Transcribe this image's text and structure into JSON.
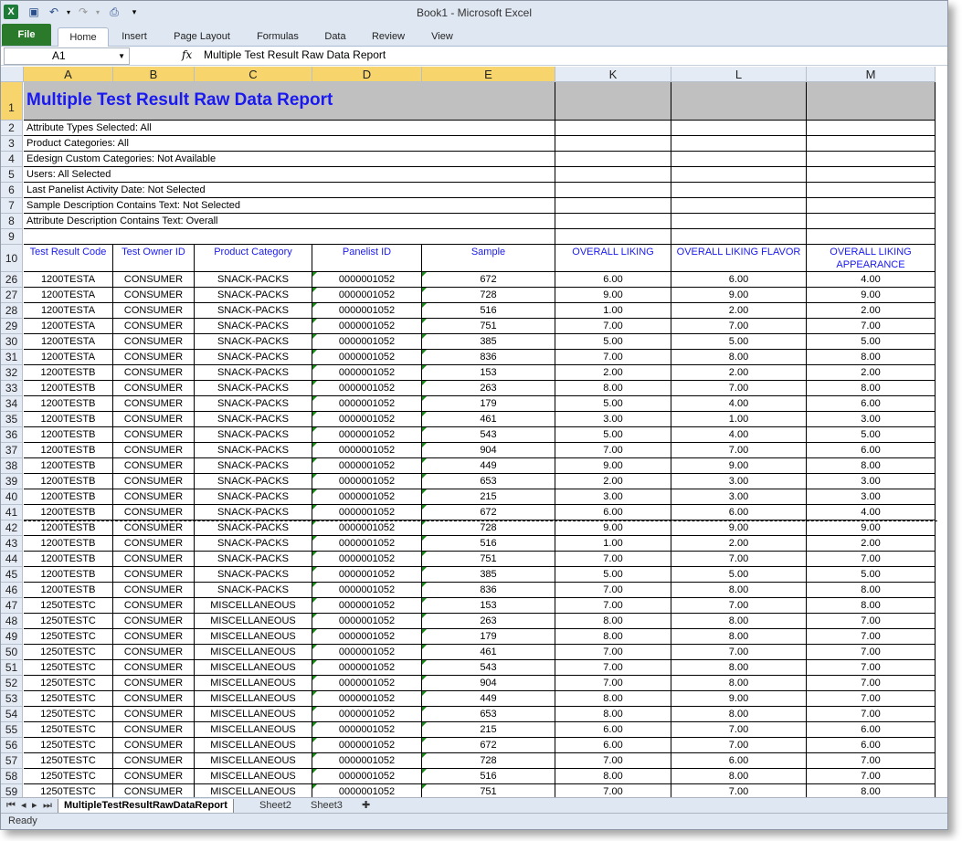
{
  "window": {
    "title": "Book1  -  Microsoft Excel"
  },
  "ribbon_tabs": [
    "File",
    "Home",
    "Insert",
    "Page Layout",
    "Formulas",
    "Data",
    "Review",
    "View"
  ],
  "formula_bar": {
    "name_box": "A1",
    "fx": "fx",
    "content": "Multiple Test Result Raw Data Report"
  },
  "columns": [
    "A",
    "B",
    "C",
    "D",
    "E",
    "K",
    "L",
    "M"
  ],
  "report": {
    "title": "Multiple Test Result Raw Data Report",
    "info_lines": [
      "Attribute Types Selected: All",
      "Product Categories: All",
      "Edesign Custom Categories:  Not Available",
      "Users:  All Selected",
      "Last Panelist Activity Date:  Not Selected",
      "Sample Description Contains Text:  Not Selected",
      "Attribute Description Contains Text:  Overall"
    ],
    "headers": [
      "Test Result Code",
      "Test Owner ID",
      "Product Category",
      "Panelist ID",
      "Sample",
      "OVERALL LIKING",
      "OVERALL LIKING FLAVOR",
      "OVERALL LIKING APPEARANCE"
    ],
    "rows": [
      [
        "26",
        "1200TESTA",
        "CONSUMER",
        "SNACK-PACKS",
        "0000001052",
        "672",
        "6.00",
        "6.00",
        "4.00"
      ],
      [
        "27",
        "1200TESTA",
        "CONSUMER",
        "SNACK-PACKS",
        "0000001052",
        "728",
        "9.00",
        "9.00",
        "9.00"
      ],
      [
        "28",
        "1200TESTA",
        "CONSUMER",
        "SNACK-PACKS",
        "0000001052",
        "516",
        "1.00",
        "2.00",
        "2.00"
      ],
      [
        "29",
        "1200TESTA",
        "CONSUMER",
        "SNACK-PACKS",
        "0000001052",
        "751",
        "7.00",
        "7.00",
        "7.00"
      ],
      [
        "30",
        "1200TESTA",
        "CONSUMER",
        "SNACK-PACKS",
        "0000001052",
        "385",
        "5.00",
        "5.00",
        "5.00"
      ],
      [
        "31",
        "1200TESTA",
        "CONSUMER",
        "SNACK-PACKS",
        "0000001052",
        "836",
        "7.00",
        "8.00",
        "8.00"
      ],
      [
        "32",
        "1200TESTB",
        "CONSUMER",
        "SNACK-PACKS",
        "0000001052",
        "153",
        "2.00",
        "2.00",
        "2.00"
      ],
      [
        "33",
        "1200TESTB",
        "CONSUMER",
        "SNACK-PACKS",
        "0000001052",
        "263",
        "8.00",
        "7.00",
        "8.00"
      ],
      [
        "34",
        "1200TESTB",
        "CONSUMER",
        "SNACK-PACKS",
        "0000001052",
        "179",
        "5.00",
        "4.00",
        "6.00"
      ],
      [
        "35",
        "1200TESTB",
        "CONSUMER",
        "SNACK-PACKS",
        "0000001052",
        "461",
        "3.00",
        "1.00",
        "3.00"
      ],
      [
        "36",
        "1200TESTB",
        "CONSUMER",
        "SNACK-PACKS",
        "0000001052",
        "543",
        "5.00",
        "4.00",
        "5.00"
      ],
      [
        "37",
        "1200TESTB",
        "CONSUMER",
        "SNACK-PACKS",
        "0000001052",
        "904",
        "7.00",
        "7.00",
        "6.00"
      ],
      [
        "38",
        "1200TESTB",
        "CONSUMER",
        "SNACK-PACKS",
        "0000001052",
        "449",
        "9.00",
        "9.00",
        "8.00"
      ],
      [
        "39",
        "1200TESTB",
        "CONSUMER",
        "SNACK-PACKS",
        "0000001052",
        "653",
        "2.00",
        "3.00",
        "3.00"
      ],
      [
        "40",
        "1200TESTB",
        "CONSUMER",
        "SNACK-PACKS",
        "0000001052",
        "215",
        "3.00",
        "3.00",
        "3.00"
      ],
      [
        "41",
        "1200TESTB",
        "CONSUMER",
        "SNACK-PACKS",
        "0000001052",
        "672",
        "6.00",
        "6.00",
        "4.00"
      ],
      [
        "42",
        "1200TESTB",
        "CONSUMER",
        "SNACK-PACKS",
        "0000001052",
        "728",
        "9.00",
        "9.00",
        "9.00"
      ],
      [
        "43",
        "1200TESTB",
        "CONSUMER",
        "SNACK-PACKS",
        "0000001052",
        "516",
        "1.00",
        "2.00",
        "2.00"
      ],
      [
        "44",
        "1200TESTB",
        "CONSUMER",
        "SNACK-PACKS",
        "0000001052",
        "751",
        "7.00",
        "7.00",
        "7.00"
      ],
      [
        "45",
        "1200TESTB",
        "CONSUMER",
        "SNACK-PACKS",
        "0000001052",
        "385",
        "5.00",
        "5.00",
        "5.00"
      ],
      [
        "46",
        "1200TESTB",
        "CONSUMER",
        "SNACK-PACKS",
        "0000001052",
        "836",
        "7.00",
        "8.00",
        "8.00"
      ],
      [
        "47",
        "1250TESTC",
        "CONSUMER",
        "MISCELLANEOUS",
        "0000001052",
        "153",
        "7.00",
        "7.00",
        "8.00"
      ],
      [
        "48",
        "1250TESTC",
        "CONSUMER",
        "MISCELLANEOUS",
        "0000001052",
        "263",
        "8.00",
        "8.00",
        "7.00"
      ],
      [
        "49",
        "1250TESTC",
        "CONSUMER",
        "MISCELLANEOUS",
        "0000001052",
        "179",
        "8.00",
        "8.00",
        "7.00"
      ],
      [
        "50",
        "1250TESTC",
        "CONSUMER",
        "MISCELLANEOUS",
        "0000001052",
        "461",
        "7.00",
        "7.00",
        "7.00"
      ],
      [
        "51",
        "1250TESTC",
        "CONSUMER",
        "MISCELLANEOUS",
        "0000001052",
        "543",
        "7.00",
        "8.00",
        "7.00"
      ],
      [
        "52",
        "1250TESTC",
        "CONSUMER",
        "MISCELLANEOUS",
        "0000001052",
        "904",
        "7.00",
        "8.00",
        "7.00"
      ],
      [
        "53",
        "1250TESTC",
        "CONSUMER",
        "MISCELLANEOUS",
        "0000001052",
        "449",
        "8.00",
        "9.00",
        "7.00"
      ],
      [
        "54",
        "1250TESTC",
        "CONSUMER",
        "MISCELLANEOUS",
        "0000001052",
        "653",
        "8.00",
        "8.00",
        "7.00"
      ],
      [
        "55",
        "1250TESTC",
        "CONSUMER",
        "MISCELLANEOUS",
        "0000001052",
        "215",
        "6.00",
        "7.00",
        "6.00"
      ],
      [
        "56",
        "1250TESTC",
        "CONSUMER",
        "MISCELLANEOUS",
        "0000001052",
        "672",
        "6.00",
        "7.00",
        "6.00"
      ],
      [
        "57",
        "1250TESTC",
        "CONSUMER",
        "MISCELLANEOUS",
        "0000001052",
        "728",
        "7.00",
        "6.00",
        "7.00"
      ],
      [
        "58",
        "1250TESTC",
        "CONSUMER",
        "MISCELLANEOUS",
        "0000001052",
        "516",
        "8.00",
        "8.00",
        "7.00"
      ],
      [
        "59",
        "1250TESTC",
        "CONSUMER",
        "MISCELLANEOUS",
        "0000001052",
        "751",
        "7.00",
        "7.00",
        "8.00"
      ]
    ]
  },
  "sheet_tabs": [
    "MultipleTestResultRawDataReport",
    "Sheet2",
    "Sheet3"
  ],
  "status": "Ready"
}
